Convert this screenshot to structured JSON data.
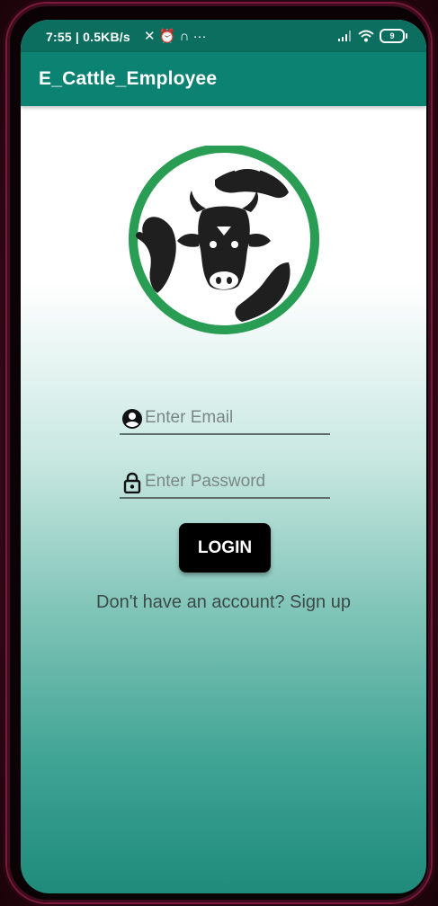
{
  "status_bar": {
    "time_speed": "7:55 | 0.5KB/s",
    "left_icons": [
      "mute-icon",
      "alarm-icon",
      "headphones-icon",
      "more-dots-icon"
    ],
    "battery_level": "9"
  },
  "app_bar": {
    "title": "E_Cattle_Employee"
  },
  "form": {
    "email_placeholder": "Enter Email",
    "password_placeholder": "Enter Password",
    "login_label": "LOGIN",
    "signup_text": "Don't have an account? Sign up"
  },
  "colors": {
    "app_bar": "#0c8272",
    "status_bar": "#0b6e5e",
    "logo_ring": "#2a9d55",
    "button": "#000000"
  }
}
